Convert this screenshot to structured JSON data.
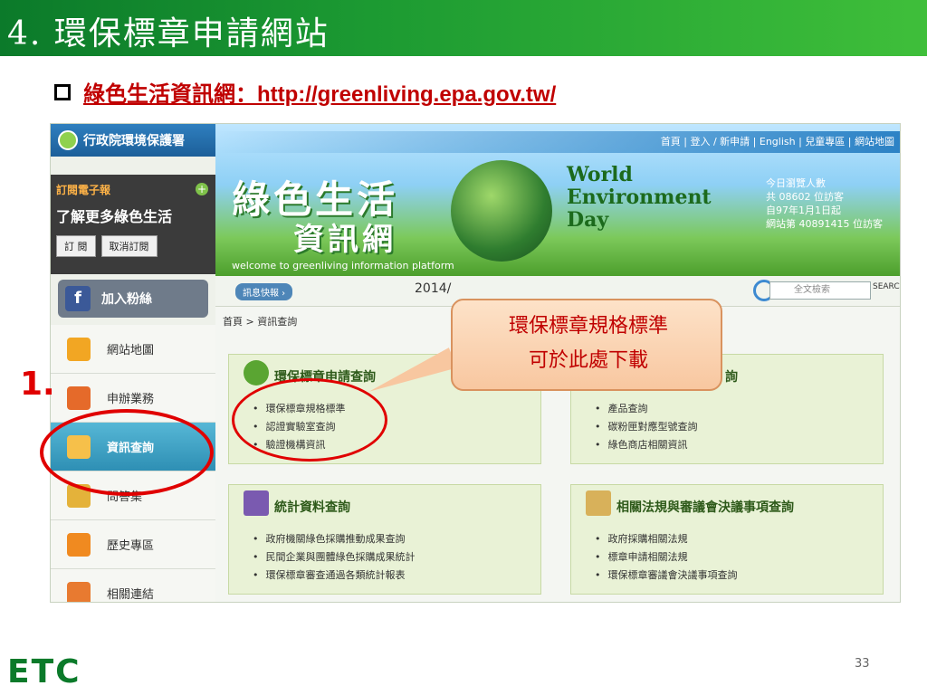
{
  "slide": {
    "title": "4. 環保標章申請網站",
    "bullet": "綠色生活資訊網：http://greenliving.epa.gov.tw/",
    "marker": "1.",
    "page_number": "33",
    "footer_logo": "ETC"
  },
  "site": {
    "logo_text": "行政院環境保護署",
    "top_links": "首頁 | 登入 / 新申請 | English | 兒童專區 | 網站地圖",
    "banner_title": "綠色生活",
    "banner_subtitle": "資訊網",
    "banner_welcome": "welcome to greenliving information platform",
    "wed_line1": "World",
    "wed_line2": "Environment",
    "wed_line3": "Day",
    "visitors_line1": "今日瀏覽人數",
    "visitors_line2": "共 08602 位訪客",
    "visitors_line3": "自97年1月1日起",
    "visitors_line4": "網站第 40891415 位訪客",
    "subscribe_title": "訂閱電子報",
    "subscribe_main": "了解更多綠色生活",
    "subscribe_btn": "訂 閱",
    "unsubscribe_btn": "取消訂閱",
    "fan_label": "加入粉絲",
    "fb_letter": "f",
    "nav": [
      {
        "label": "網站地圖"
      },
      {
        "label": "申辦業務"
      },
      {
        "label": "資訊查詢"
      },
      {
        "label": "問答集"
      },
      {
        "label": "歷史專區"
      },
      {
        "label": "相關連結"
      }
    ],
    "news_label": "訊息快報 ›",
    "date": "2014/",
    "search_placeholder": "全文檢索",
    "search_button": "SEARCH",
    "breadcrumb": "首頁 > 資訊查詢",
    "panels": [
      {
        "title": "環保標章申請查詢",
        "items": [
          "環保標章規格標準",
          "認證實驗室查詢",
          "驗證機構資訊"
        ]
      },
      {
        "title": "詢",
        "items": [
          "產品查詢",
          "碳粉匣對應型號查詢",
          "綠色商店相關資訊"
        ]
      },
      {
        "title": "統計資料查詢",
        "items": [
          "政府機關綠色採購推動成果查詢",
          "民間企業與團體綠色採購成果統計",
          "環保標章審查通過各類統計報表"
        ]
      },
      {
        "title": "相關法規與審議會決議事項查詢",
        "items": [
          "政府採購相關法規",
          "標章申請相關法規",
          "環保標章審議會決議事項查詢"
        ]
      }
    ],
    "callout_line1": "環保標章規格標準",
    "callout_line2": "可於此處下載"
  },
  "colors": {
    "title_bar": "#1c9a32",
    "accent_red": "#c00000",
    "nav_active": "#2e8fb4"
  }
}
